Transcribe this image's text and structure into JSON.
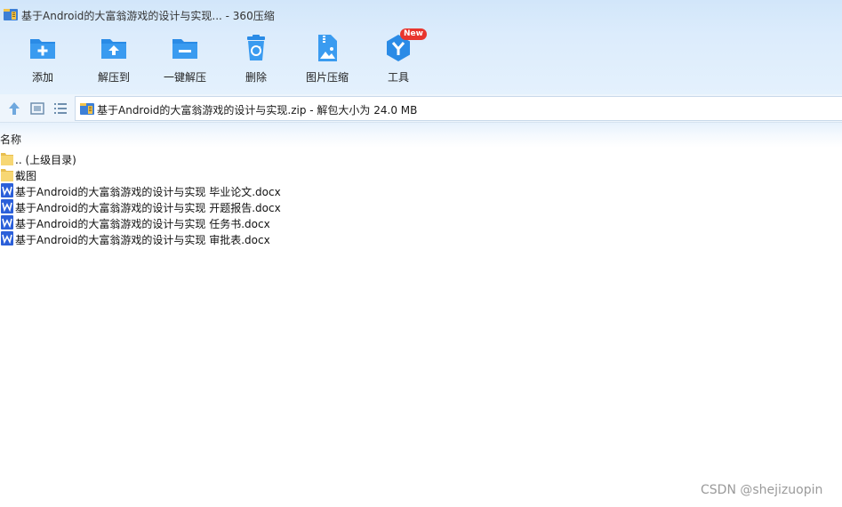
{
  "window": {
    "title": "基于Android的大富翁游戏的设计与实现... - 360压缩"
  },
  "toolbar": {
    "buttons": [
      {
        "label": "添加",
        "icon": "add-folder-icon"
      },
      {
        "label": "解压到",
        "icon": "extract-to-icon"
      },
      {
        "label": "一键解压",
        "icon": "one-click-extract-icon"
      },
      {
        "label": "删除",
        "icon": "recycle-bin-icon"
      },
      {
        "label": "图片压缩",
        "icon": "image-compress-icon"
      },
      {
        "label": "工具",
        "icon": "tools-icon",
        "badge": "New"
      }
    ]
  },
  "navbar": {
    "address": "基于Android的大富翁游戏的设计与实现.zip - 解包大小为 24.0 MB"
  },
  "list": {
    "column_name": "名称",
    "items": [
      {
        "name": ".. (上级目录)",
        "type": "folder"
      },
      {
        "name": "截图",
        "type": "folder"
      },
      {
        "name": "基于Android的大富翁游戏的设计与实现 毕业论文.docx",
        "type": "docx"
      },
      {
        "name": "基于Android的大富翁游戏的设计与实现 开题报告.docx",
        "type": "docx"
      },
      {
        "name": "基于Android的大富翁游戏的设计与实现 任务书.docx",
        "type": "docx"
      },
      {
        "name": "基于Android的大富翁游戏的设计与实现 审批表.docx",
        "type": "docx"
      }
    ]
  },
  "watermark": "CSDN @shejizuopin",
  "colors": {
    "accent": "#2a8be6",
    "badge": "#e8352e",
    "folder": "#f7d774",
    "word": "#2b5fd9"
  }
}
